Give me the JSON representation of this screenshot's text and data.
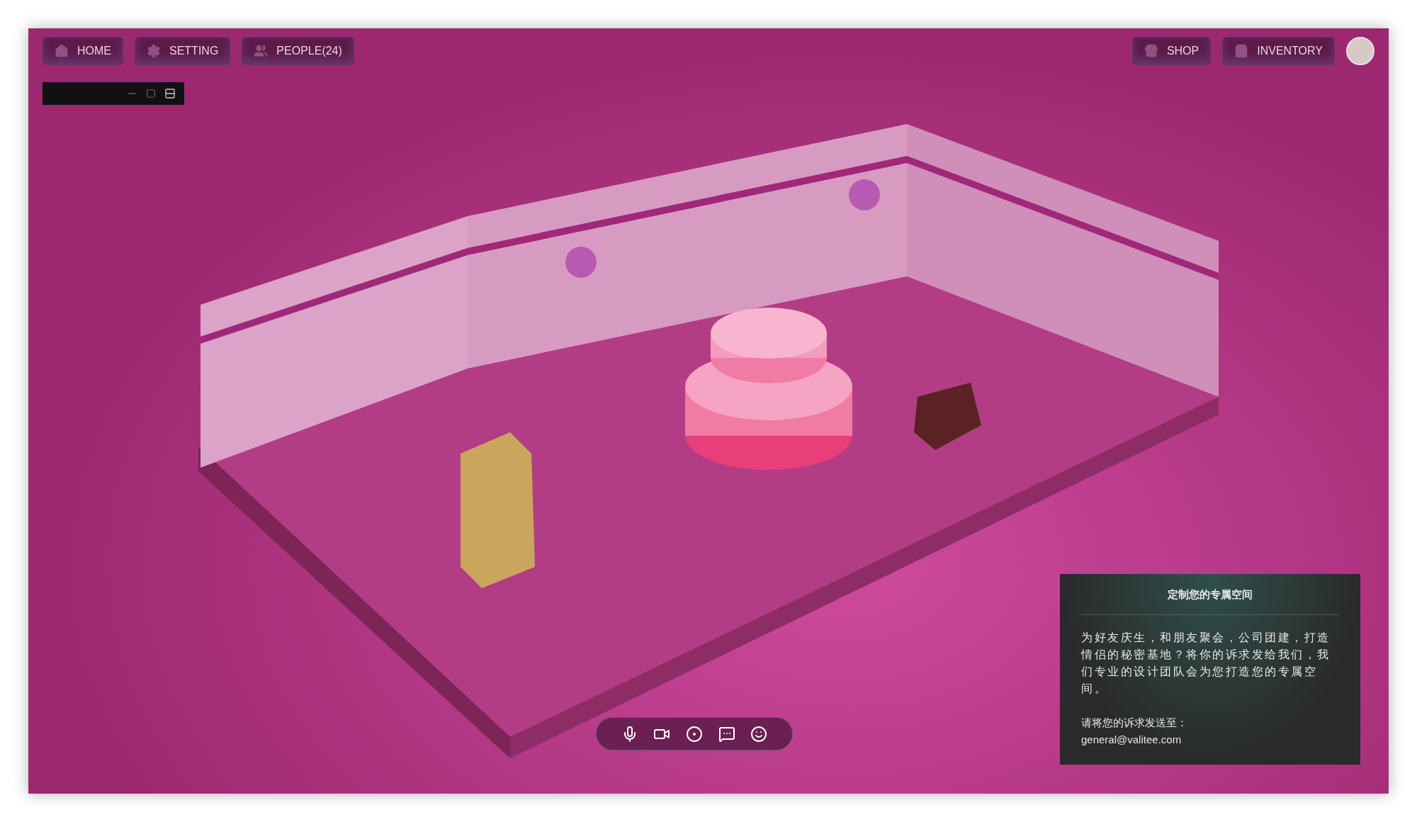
{
  "nav_left": [
    {
      "label": "HOME"
    },
    {
      "label": "SETTING"
    },
    {
      "label": "PEOPLE(24)"
    }
  ],
  "nav_right": [
    {
      "label": "SHOP"
    },
    {
      "label": "INVENTORY"
    }
  ],
  "info_panel": {
    "title": "定制您的专属空间",
    "body": "为好友庆生，和朋友聚会，公司团建，打造情侣的秘密基地？将你的诉求发给我们，我们专业的设计团队会为您打造您的专属空间。",
    "contact_label": "请将您的诉求发送至：",
    "email": "general@valitee.com"
  }
}
